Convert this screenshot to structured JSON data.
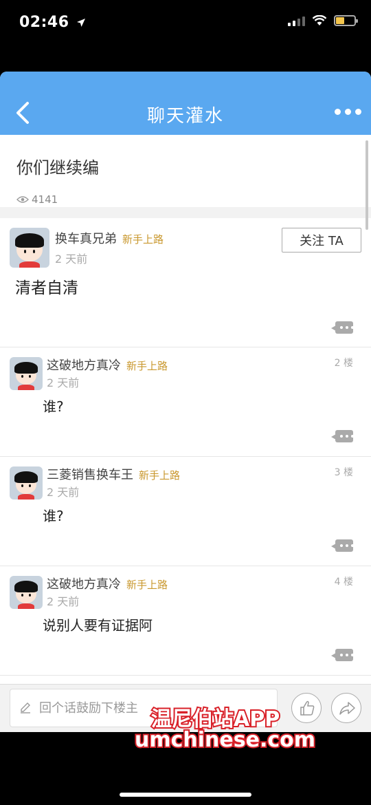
{
  "status": {
    "time": "02:46"
  },
  "nav": {
    "title": "聊天灌水"
  },
  "topic": {
    "title": "你们继续编",
    "views": "4141"
  },
  "main_post": {
    "author": "换车真兄弟",
    "badge": "新手上路",
    "time": "2 天前",
    "follow_label": "关注 TA",
    "content": "清者自清"
  },
  "replies": [
    {
      "author": "这破地方真冷",
      "badge": "新手上路",
      "time": "2 天前",
      "floor": "2 楼",
      "content": "谁?"
    },
    {
      "author": "三菱销售换车王",
      "badge": "新手上路",
      "time": "2 天前",
      "floor": "3 楼",
      "content": "谁?"
    },
    {
      "author": "这破地方真冷",
      "badge": "新手上路",
      "time": "2 天前",
      "floor": "4 楼",
      "content": "说别人要有证据阿"
    }
  ],
  "bottom": {
    "reply_placeholder": "回个话鼓励下楼主"
  },
  "watermark": {
    "line1": "温尼伯站APP",
    "line2": "umchinese.com"
  },
  "colors": {
    "nav_bg": "#5aa8f0",
    "badge": "#c9982e",
    "watermark_stroke": "#d9222a"
  }
}
